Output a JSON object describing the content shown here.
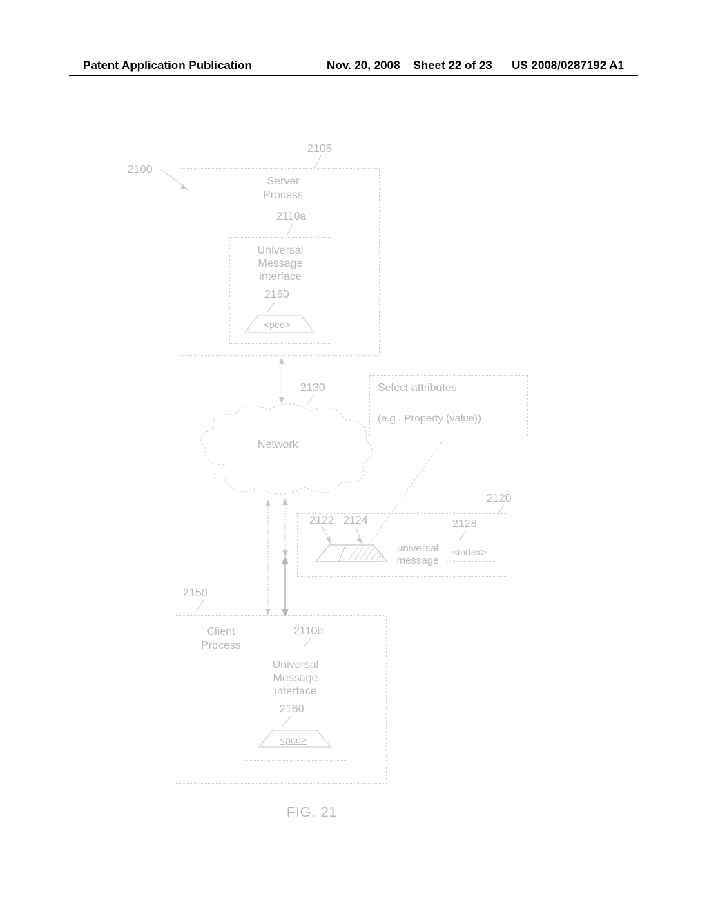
{
  "header": {
    "left": "Patent Application Publication",
    "date": "Nov. 20, 2008",
    "sheet": "Sheet 22 of 23",
    "pubno": "US 2008/0287192 A1"
  },
  "refs": {
    "r2100": "2100",
    "r2106": "2106",
    "r2110a": "2110a",
    "r2110b": "2110b",
    "r2120": "2120",
    "r2122": "2122",
    "r2124": "2124",
    "r2128": "2128",
    "r2130": "2130",
    "r2150": "2150",
    "r2160a": "2160",
    "r2160b": "2160"
  },
  "labels": {
    "server_process": "Server\nProcess",
    "client_process": "Client\nProcess",
    "umi": "Universal\nMessage\ninterface",
    "pco": "<pco>",
    "network": "Network",
    "select_attr_l1": "Select attributes",
    "select_attr_l2": "(e.g.,   Property (value))",
    "universal_message": "universal\nmessage",
    "index": "<index>"
  },
  "figure_caption": "FIG. 21"
}
